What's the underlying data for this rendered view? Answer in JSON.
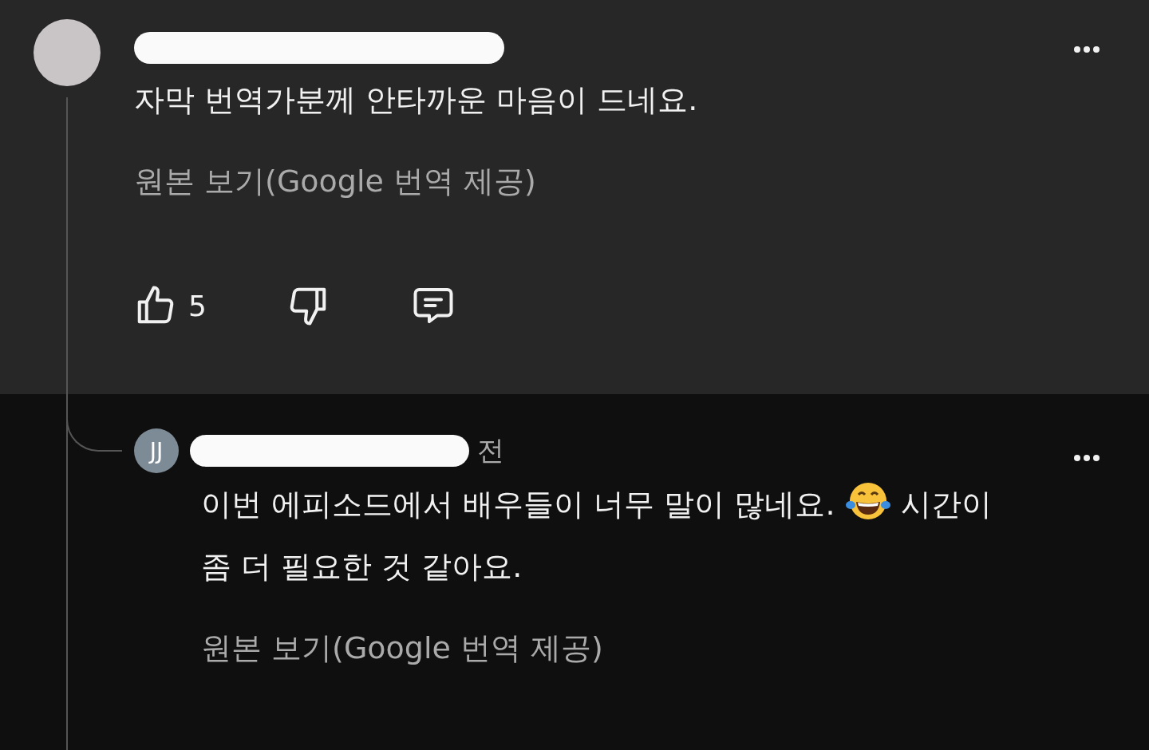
{
  "comment": {
    "author_redacted": true,
    "text": "자막 번역가분께 안타까운 마음이 드네요.",
    "translate_link": "원본 보기(Google 번역 제공)",
    "likes": "5"
  },
  "reply": {
    "avatar_initials": "JJ",
    "author_redacted": true,
    "meta_tail": "전",
    "text_before_emoji": "이번 에피소드에서 배우들이 너무 말이 많네요.",
    "text_after_emoji": "시간이 좀 더 필요한 것 같아요.",
    "translate_link": "원본 보기(Google 번역 제공)"
  }
}
